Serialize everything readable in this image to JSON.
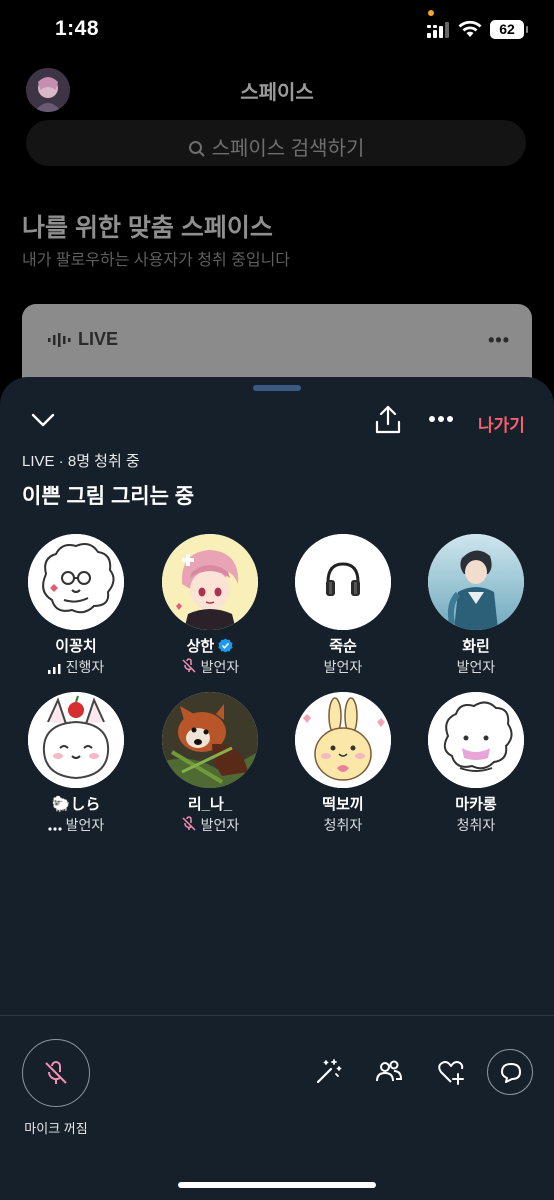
{
  "status_bar": {
    "time": "1:48",
    "battery": "62"
  },
  "background_page": {
    "title": "스페이스",
    "search_placeholder": "스페이스 검색하기",
    "heading": "나를 위한 맞춤 스페이스",
    "subheading": "내가 팔로우하는 사용자가 청취 중입니다",
    "card_live_label": "LIVE"
  },
  "space": {
    "leave_label": "나가기",
    "meta": "LIVE · 8명 청취 중",
    "title": "이쁜 그림 그리는 중"
  },
  "participants": [
    {
      "name": "이꽁치",
      "role": "진행자",
      "status_icon": "speaking-bars-icon"
    },
    {
      "name": "상한",
      "role": "발언자",
      "status_icon": "mic-off-icon",
      "verified": true
    },
    {
      "name": "죽순",
      "role": "발언자"
    },
    {
      "name": "화린",
      "role": "발언자"
    },
    {
      "name": "しら",
      "name_prefix_emoji": "🐑",
      "role": "발언자",
      "status_icon": "dots-icon"
    },
    {
      "name": "리_나_",
      "role": "발언자",
      "status_icon": "mic-off-icon"
    },
    {
      "name": "떡보끼",
      "role": "청취자"
    },
    {
      "name": "마카롱",
      "role": "청취자"
    }
  ],
  "controls": {
    "mic_label": "마이크 꺼짐"
  },
  "colors": {
    "sheet_bg": "#16202b",
    "leave": "#f4606c",
    "mic_off_pink": "#f48fb1",
    "verified_blue": "#1d9bf0"
  }
}
